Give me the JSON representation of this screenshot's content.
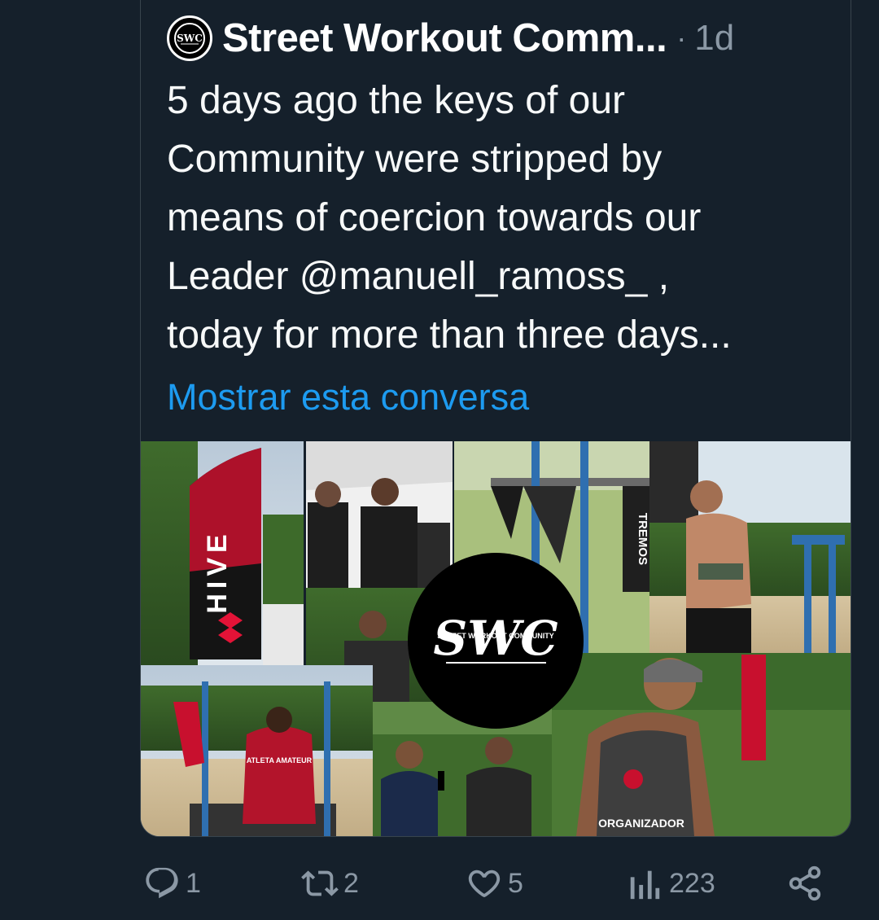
{
  "tweet": {
    "author": "Street Workout Comm...",
    "separator": "·",
    "time": "1d",
    "text_lines": [
      "5 days ago the keys of our",
      "Community were stripped by",
      "means of coercion towards our",
      "Leader @manuell_ramoss_ ,",
      "today for more than three days..."
    ],
    "show_conversation": "Mostrar esta conversa"
  },
  "media": {
    "logo_text": "SWC",
    "logo_subtext": "STREET WORKOUT COMMUNITY",
    "banner_text": "HIVE",
    "sign_text": "TREMOS",
    "shirt_red_text": "ATLETA AMATEUR",
    "shirt_gray_text": "ORGANIZADOR"
  },
  "actions": {
    "replies": "1",
    "retweets": "2",
    "likes": "5",
    "views": "223"
  },
  "colors": {
    "background": "#15202b",
    "text": "#f7f9f9",
    "muted": "#8b98a5",
    "link": "#1d9bf0",
    "hive_red": "#e31337"
  }
}
